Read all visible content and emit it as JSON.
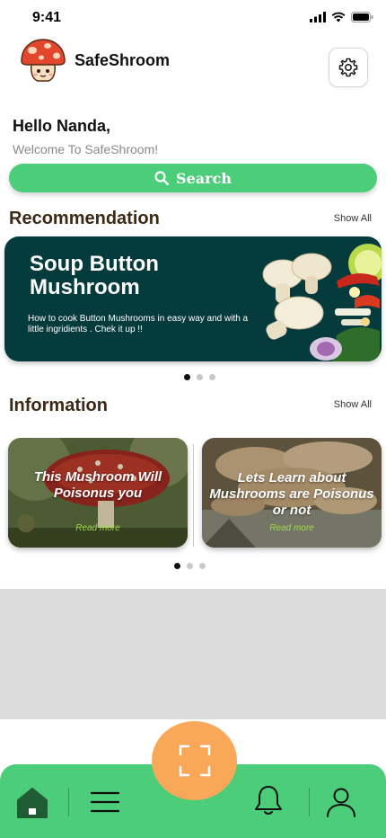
{
  "status_bar": {
    "time": "9:41"
  },
  "header": {
    "app_name": "SafeShroom",
    "logo_icon": "mushroom-logo-icon",
    "settings_icon": "gear-icon"
  },
  "greeting": {
    "title": "Hello Nanda,",
    "subtitle": "Welcome To SafeShroom!"
  },
  "search": {
    "label": "Search",
    "icon": "search-icon"
  },
  "recommendation": {
    "section_title": "Recommendation",
    "show_all": "Show All",
    "card": {
      "title": "Soup Button Mushroom",
      "description": "How to cook Button Mushrooms in easy way and with a little ingridients . Chek it up !!"
    },
    "carousel_active_index": 0,
    "carousel_count": 3
  },
  "information": {
    "section_title": "Information",
    "show_all": "Show All",
    "cards": [
      {
        "title": "This Mushroom Will Poisonus you",
        "link": "Read more"
      },
      {
        "title": "Lets Learn about Mushrooms are Poisonus or not",
        "link": "Read more"
      }
    ],
    "carousel_active_index": 0,
    "carousel_count": 3
  },
  "bottom_nav": {
    "items": [
      "home-icon",
      "menu-icon",
      "scan-icon",
      "bell-icon",
      "user-icon"
    ]
  },
  "colors": {
    "accent_green": "#4ccd7a",
    "banner_teal": "#063b3d",
    "scan_orange": "#f9a85a",
    "heading_brown": "#3c2a17",
    "read_more_green": "#9bdc42"
  }
}
